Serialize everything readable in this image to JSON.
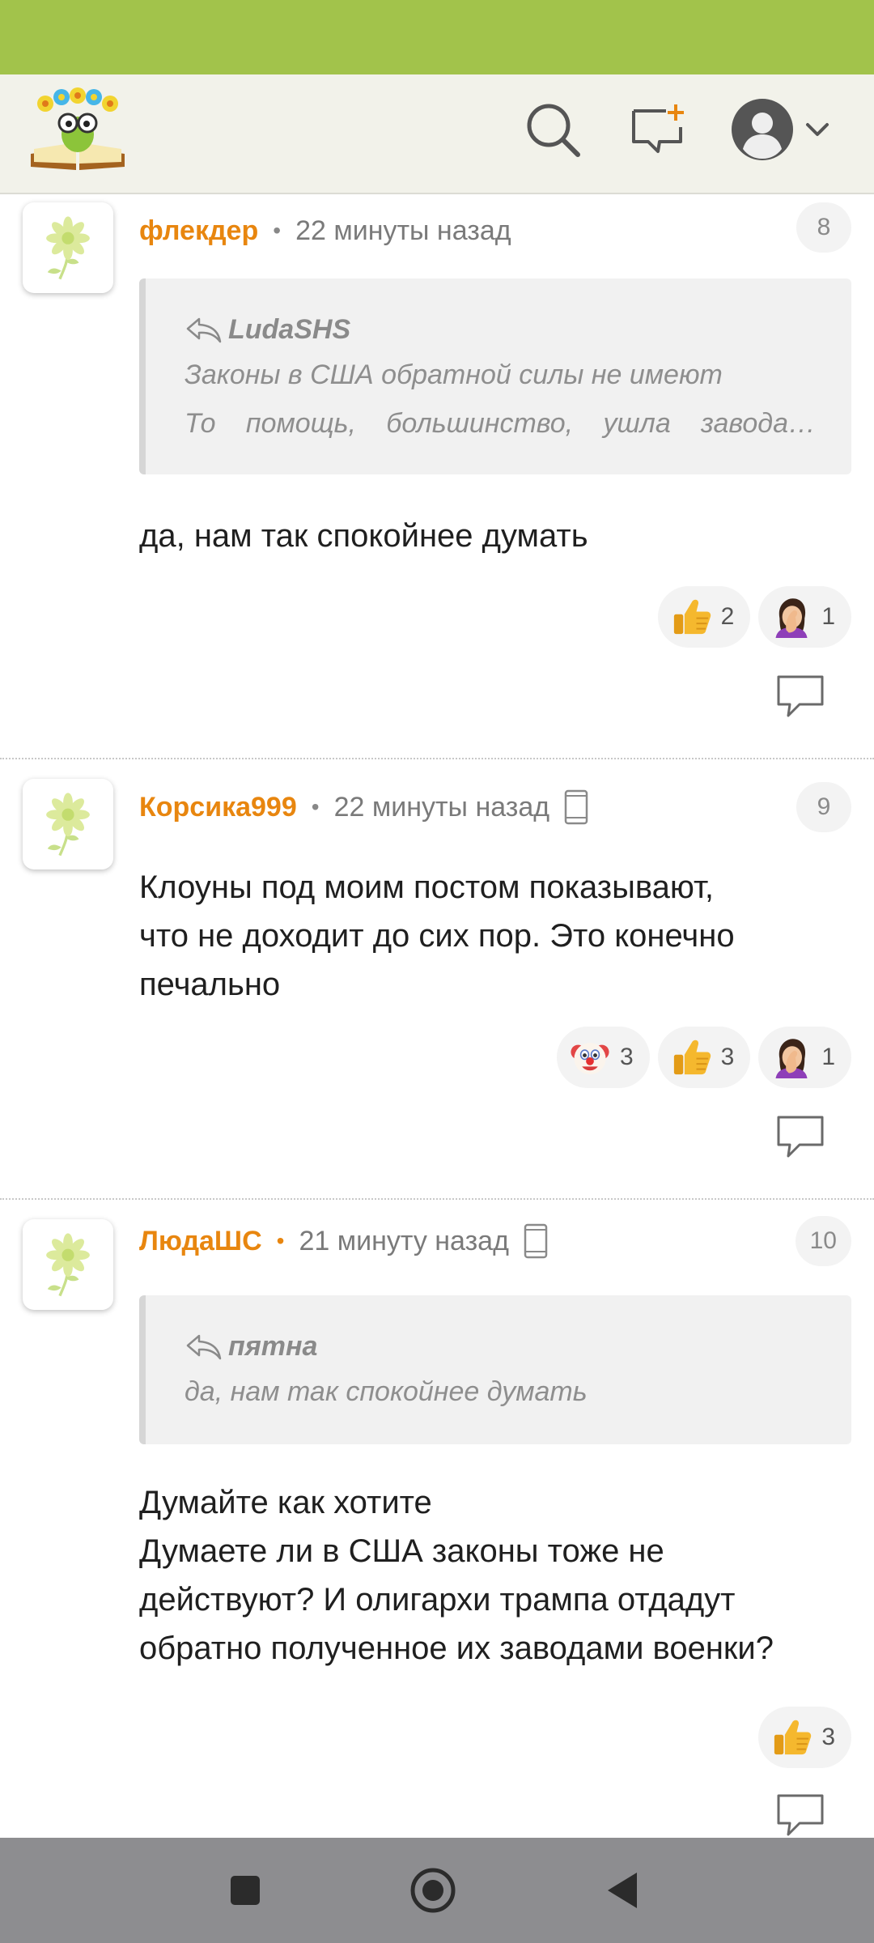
{
  "header": {
    "logo_alt": "flower-book mascot logo"
  },
  "comments": [
    {
      "author": "флекдер",
      "time": "22 минуты назад",
      "number": "8",
      "quote": {
        "author": "LudaSHS",
        "line1": "Законы в США обратной силы не имеют",
        "line2_words": [
          "То",
          "помощь,",
          "большинство,",
          "ушла",
          "завода…"
        ]
      },
      "text": "да, нам так спокойнее думать",
      "reactions": [
        {
          "emoji": "thumbs-up",
          "count": "2"
        },
        {
          "emoji": "facepalm-woman",
          "count": "1"
        }
      ]
    },
    {
      "author": "Корсика999",
      "time": "22 минуты назад",
      "number": "9",
      "text": "Клоуны под моим постом показывают,\nчто не доходит до сих пор. Это конечно\nпечально",
      "reactions": [
        {
          "emoji": "clown-face",
          "count": "3"
        },
        {
          "emoji": "thumbs-up",
          "count": "3"
        },
        {
          "emoji": "facepalm-woman",
          "count": "1"
        }
      ]
    },
    {
      "author": "ЛюдаШС",
      "time": "21 минуту назад",
      "number": "10",
      "quote": {
        "author": "пятна",
        "line1": "да, нам так спокойнее думать"
      },
      "text": "Думайте как хотите\nДумаете ли в США законы тоже не\nдействуют? И олигархи трампа отдадут\nобратно полученное их заводами военки?",
      "reactions": [
        {
          "emoji": "thumbs-up",
          "count": "3"
        }
      ]
    }
  ],
  "colors": {
    "status_bar": "#a2c34b",
    "author": "#e8860f",
    "header_bg": "#f2f2ea",
    "nav_bar": "#8d8d90"
  }
}
